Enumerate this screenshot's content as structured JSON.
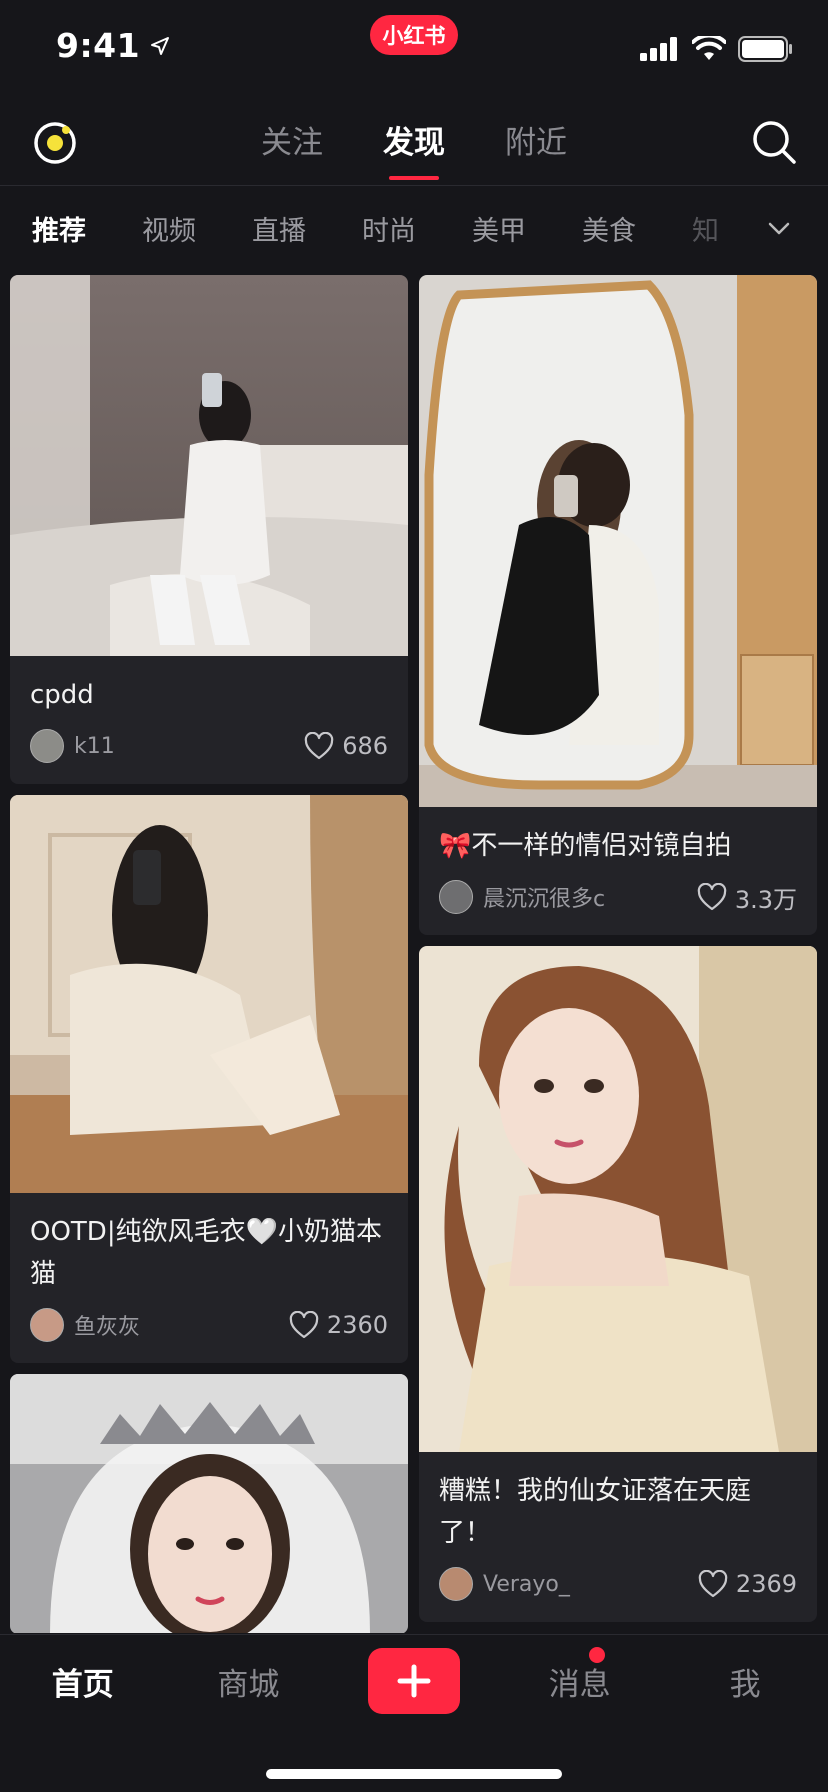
{
  "status_bar": {
    "time": "9:41",
    "app_badge": "小红书"
  },
  "top_nav": {
    "tabs": [
      {
        "label": "关注"
      },
      {
        "label": "发现"
      },
      {
        "label": "附近"
      }
    ],
    "active_tab": "发现"
  },
  "categories": {
    "items": [
      {
        "label": "推荐"
      },
      {
        "label": "视频"
      },
      {
        "label": "直播"
      },
      {
        "label": "时尚"
      },
      {
        "label": "美甲"
      },
      {
        "label": "美食"
      },
      {
        "label": "知"
      }
    ],
    "active": "推荐"
  },
  "feed": {
    "left": [
      {
        "title": "cpdd",
        "author": "k11",
        "likes": "686"
      },
      {
        "title": "OOTD|纯欲风毛衣🤍小奶猫本猫",
        "author": "鱼灰灰",
        "likes": "2360"
      },
      {
        "title": "",
        "author": "",
        "likes": ""
      }
    ],
    "right": [
      {
        "title": "🎀不一样的情侣对镜自拍",
        "author": "晨沉沉很多c",
        "likes": "3.3万"
      },
      {
        "title": "糟糕！我的仙女证落在天庭了！",
        "author": "Verayo_",
        "likes": "2369"
      }
    ]
  },
  "tab_bar": {
    "items": [
      {
        "label": "首页"
      },
      {
        "label": "商城"
      },
      {
        "label": "+"
      },
      {
        "label": "消息"
      },
      {
        "label": "我"
      }
    ],
    "active": "首页"
  },
  "colors": {
    "accent": "#ff2741",
    "background": "#16161a",
    "card": "#232328"
  }
}
